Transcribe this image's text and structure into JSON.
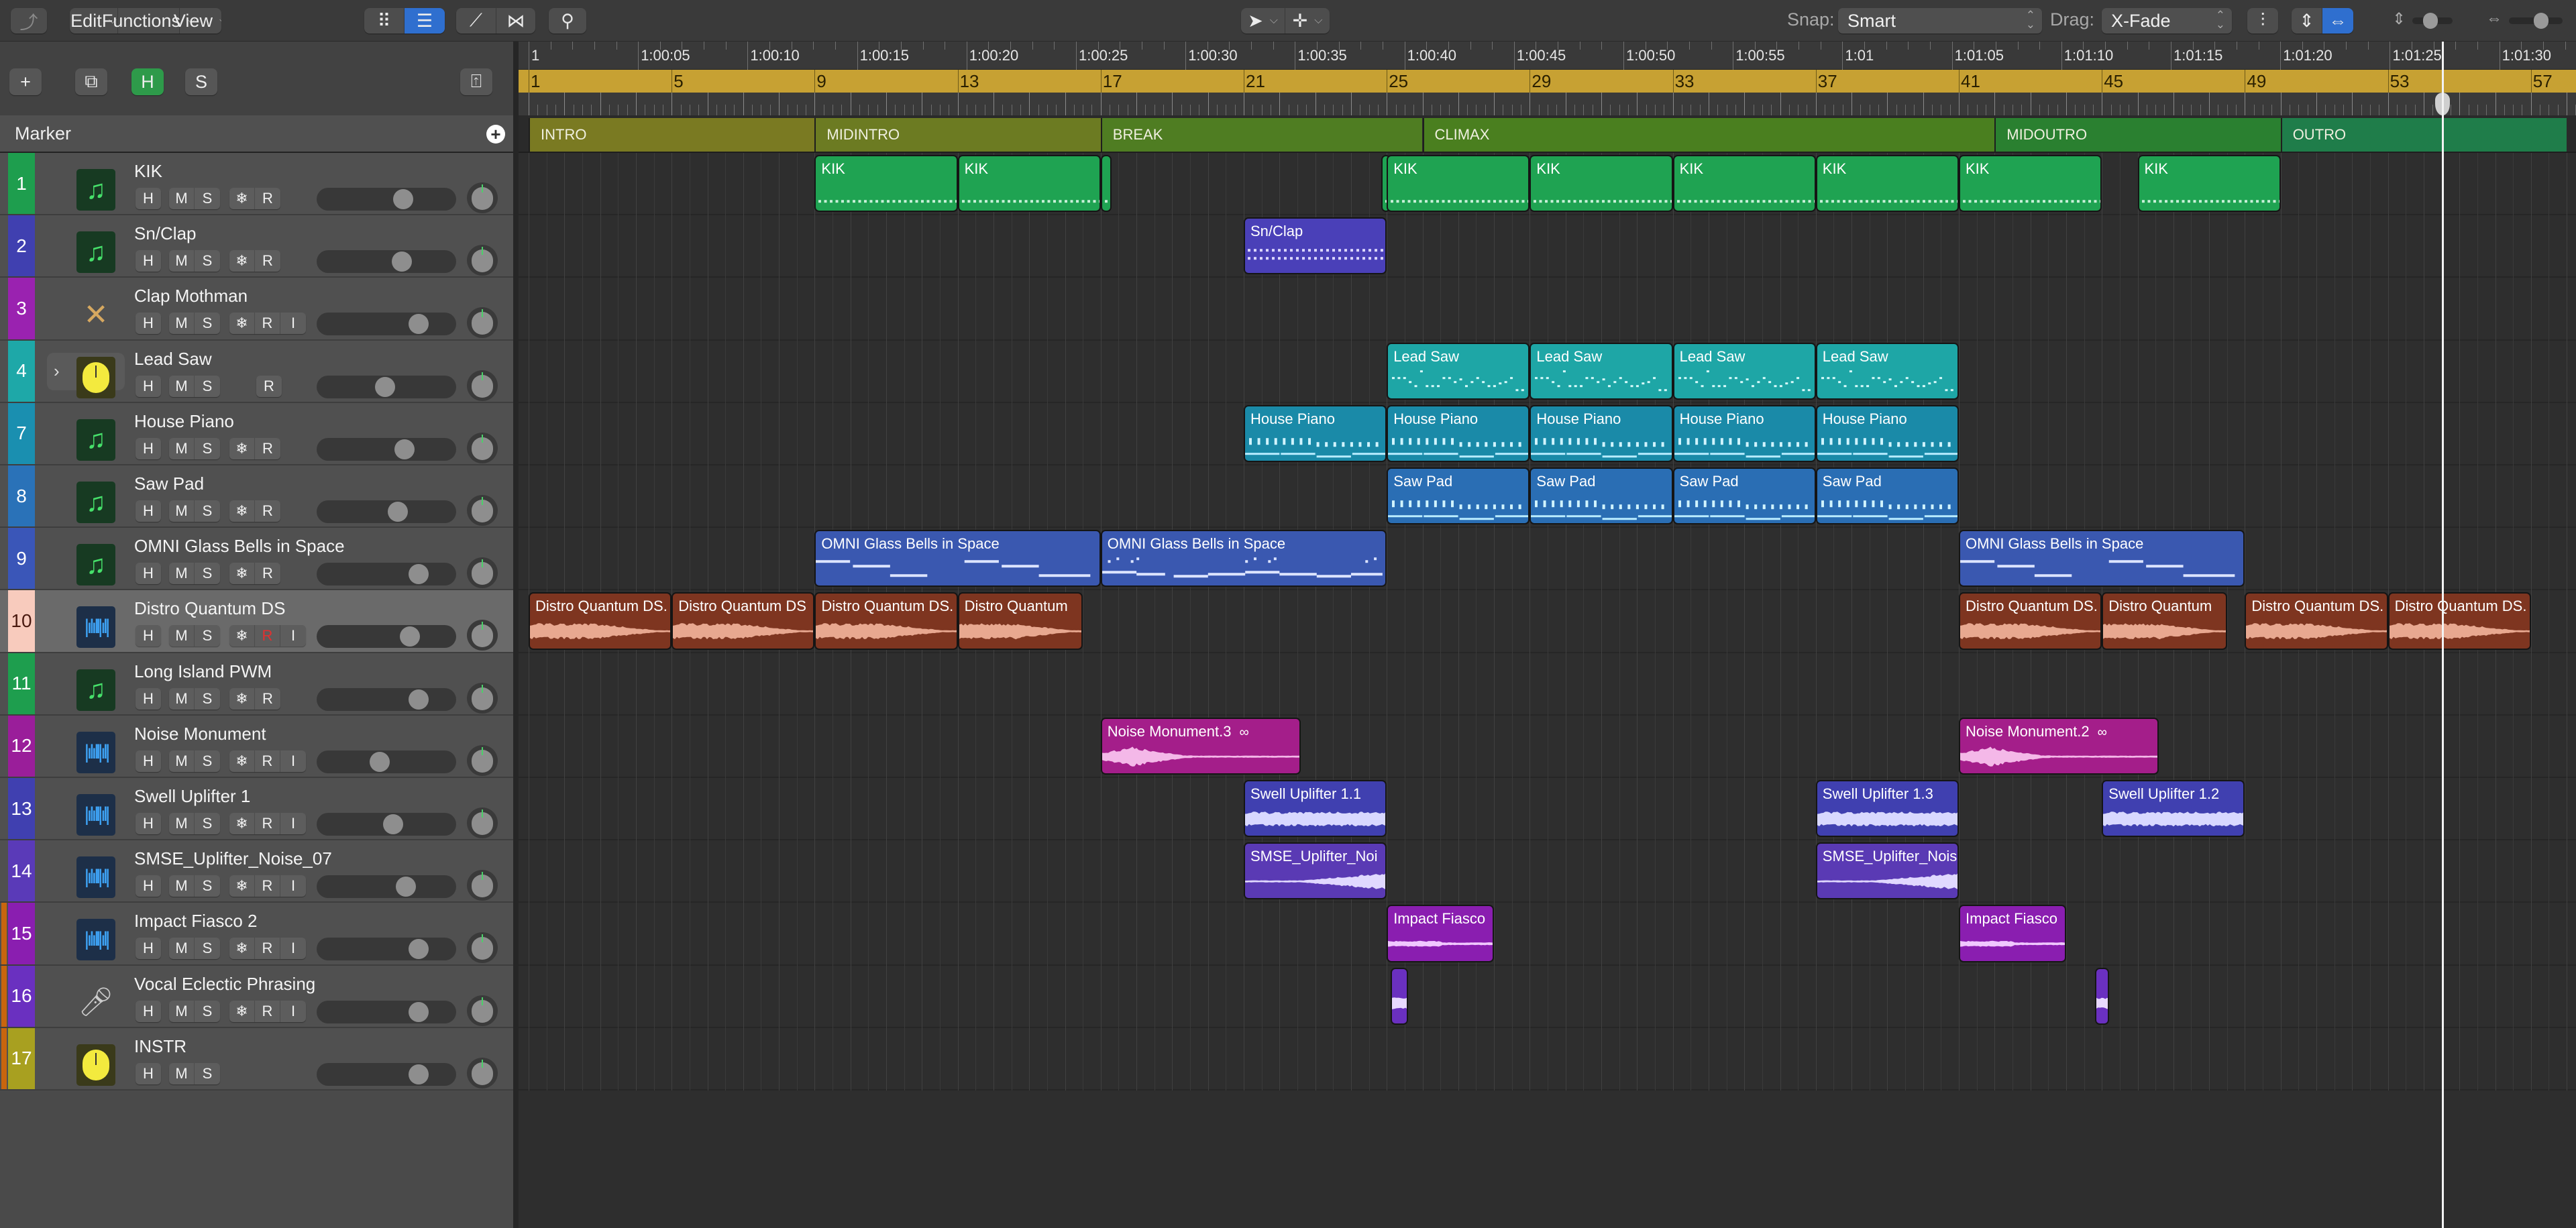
{
  "toolbar": {
    "back_icon": "back-arrow-icon",
    "menus": [
      {
        "label": "Edit",
        "icon": "chevron-down-icon"
      },
      {
        "label": "Functions",
        "icon": "chevron-down-icon"
      },
      {
        "label": "View",
        "icon": "chevron-down-icon"
      }
    ],
    "view_buttons": [
      {
        "icon": "grid-view-icon",
        "active": false
      },
      {
        "icon": "list-view-icon",
        "active": true
      }
    ],
    "automation_buttons": [
      {
        "icon": "automation-curve-icon"
      },
      {
        "icon": "flex-icon"
      }
    ],
    "catch_icon": "catch-playhead-icon",
    "tools": [
      {
        "icon": "pointer-tool-icon"
      },
      {
        "icon": "crosshair-tool-icon"
      }
    ],
    "snap_label": "Snap:",
    "snap_value": "Smart",
    "drag_label": "Drag:",
    "drag_value": "X-Fade",
    "waveform_zoom_icon": "waveform-zoom-icon",
    "vertical_fit_icon": "vertical-fit-icon",
    "horizontal_fit_icon": "horizontal-fit-icon",
    "vertical_zoom_icon": "vertical-zoom-icon",
    "horizontal_zoom_icon": "horizontal-zoom-icon",
    "vertical_zoom_level": 0.45,
    "horizontal_zoom_level": 0.6
  },
  "header_tools": {
    "add_label": "+",
    "duplicate_icon": "duplicate-track-icon",
    "h_label": "H",
    "s_label": "S",
    "collapse_icon": "collapse-panel-icon"
  },
  "marker_track": {
    "label": "Marker",
    "add_icon": "plus-circle-icon"
  },
  "ruler": {
    "time_labels": [
      "1",
      "1:00:05",
      "1:00:10",
      "1:00:15",
      "1:00:20",
      "1:00:25",
      "1:00:30",
      "1:00:35",
      "1:00:40",
      "1:00:45",
      "1:00:50",
      "1:00:55",
      "1:01",
      "1:01:05",
      "1:01:10",
      "1:01:15",
      "1:01:20",
      "1:01:25",
      "1:01:30"
    ],
    "bar_labels": [
      "1",
      "5",
      "9",
      "13",
      "17",
      "21",
      "25",
      "29",
      "33",
      "37",
      "41",
      "45",
      "49",
      "53",
      "57"
    ],
    "playhead_bar": 54.5
  },
  "markers": [
    {
      "name": "INTRO",
      "start": 1,
      "end": 9,
      "color": "#7a7a22"
    },
    {
      "name": "MIDINTRO",
      "start": 9,
      "end": 17,
      "color": "#6c7b22"
    },
    {
      "name": "BREAK",
      "start": 17,
      "end": 26,
      "color": "#4f7d22"
    },
    {
      "name": "CLIMAX",
      "start": 26,
      "end": 42,
      "color": "#4a7f1f"
    },
    {
      "name": "MIDOUTRO",
      "start": 42,
      "end": 50,
      "color": "#2a8030"
    },
    {
      "name": "OUTRO",
      "start": 50,
      "end": 58,
      "color": "#1f7d4a"
    }
  ],
  "tracks": [
    {
      "number": "1",
      "name": "KIK",
      "color": "#1e9e4e",
      "icon": "midi-note-icon",
      "buttons": [
        "H",
        "M",
        "S",
        "❄",
        "R"
      ],
      "volume": 0.62,
      "selected": false,
      "folder": false,
      "expand": false
    },
    {
      "number": "2",
      "name": "Sn/Clap",
      "color": "#4040b0",
      "icon": "midi-note-icon",
      "buttons": [
        "H",
        "M",
        "S",
        "❄",
        "R"
      ],
      "volume": 0.61,
      "selected": false,
      "folder": false,
      "expand": false
    },
    {
      "number": "3",
      "name": "Clap Mothman",
      "color": "#9a22b0",
      "icon": "drumsticks-icon",
      "buttons": [
        "H",
        "M",
        "S",
        "❄",
        "R",
        "I"
      ],
      "volume": 0.73,
      "selected": false,
      "folder": false,
      "expand": false
    },
    {
      "number": "4",
      "name": "Lead Saw",
      "color": "#1ea8a8",
      "icon": "instrument-knob-icon",
      "buttons": [
        "H",
        "M",
        "S",
        "R"
      ],
      "volume": 0.49,
      "selected": false,
      "folder": false,
      "expand": true
    },
    {
      "number": "7",
      "name": "House Piano",
      "color": "#1a8fb0",
      "icon": "midi-note-icon",
      "buttons": [
        "H",
        "M",
        "S",
        "❄",
        "R"
      ],
      "volume": 0.63,
      "selected": false,
      "folder": false,
      "expand": false
    },
    {
      "number": "8",
      "name": "Saw Pad",
      "color": "#2a72b8",
      "icon": "midi-note-icon",
      "buttons": [
        "H",
        "M",
        "S",
        "❄",
        "R"
      ],
      "volume": 0.58,
      "selected": false,
      "folder": false,
      "expand": false
    },
    {
      "number": "9",
      "name": "OMNI Glass Bells in Space",
      "color": "#3a56b8",
      "icon": "midi-note-icon",
      "buttons": [
        "H",
        "M",
        "S",
        "❄",
        "R"
      ],
      "volume": 0.73,
      "selected": false,
      "folder": false,
      "expand": false
    },
    {
      "number": "10",
      "name": "Distro Quantum DS",
      "color": "#f8cbbd",
      "number_color": "#4a1a10",
      "icon": "audio-waveform-icon",
      "buttons": [
        "H",
        "M",
        "S",
        "❄",
        "R",
        "I"
      ],
      "red_button": "R",
      "volume": 0.67,
      "selected": true,
      "folder": false,
      "expand": false
    },
    {
      "number": "11",
      "name": "Long Island PWM",
      "color": "#1e9e4e",
      "icon": "midi-note-icon",
      "buttons": [
        "H",
        "M",
        "S",
        "❄",
        "R"
      ],
      "volume": 0.73,
      "selected": false,
      "folder": false,
      "expand": false
    },
    {
      "number": "12",
      "name": "Noise Monument",
      "color": "#9a1e9a",
      "icon": "audio-waveform-icon",
      "buttons": [
        "H",
        "M",
        "S",
        "❄",
        "R",
        "I"
      ],
      "volume": 0.45,
      "selected": false,
      "folder": false,
      "expand": false
    },
    {
      "number": "13",
      "name": "Swell Uplifter 1",
      "color": "#4040b0",
      "icon": "audio-waveform-icon",
      "buttons": [
        "H",
        "M",
        "S",
        "❄",
        "R",
        "I"
      ],
      "volume": 0.55,
      "selected": false,
      "folder": false,
      "expand": false
    },
    {
      "number": "14",
      "name": "SMSE_Uplifter_Noise_07",
      "color": "#5a3ab8",
      "icon": "audio-waveform-icon",
      "buttons": [
        "H",
        "M",
        "S",
        "❄",
        "R",
        "I"
      ],
      "volume": 0.64,
      "selected": false,
      "folder": false,
      "expand": false
    },
    {
      "number": "15",
      "name": "Impact Fiasco 2",
      "color": "#8a1eb0",
      "icon": "audio-waveform-icon",
      "buttons": [
        "H",
        "M",
        "S",
        "❄",
        "R",
        "I"
      ],
      "volume": 0.73,
      "selected": false,
      "folder": true,
      "expand": false
    },
    {
      "number": "16",
      "name": "Vocal Eclectic Phrasing",
      "color": "#6a30c0",
      "icon": "microphone-icon",
      "buttons": [
        "H",
        "M",
        "S",
        "❄",
        "R",
        "I"
      ],
      "volume": 0.73,
      "selected": false,
      "folder": true,
      "expand": false
    },
    {
      "number": "17",
      "name": "INSTR",
      "color": "#a8a020",
      "icon": "instrument-knob-icon",
      "buttons": [
        "H",
        "M",
        "S"
      ],
      "volume": 0.73,
      "selected": false,
      "folder": true,
      "expand": false
    }
  ],
  "regions": [
    {
      "track": 0,
      "name": "KIK",
      "start": 9,
      "end": 13,
      "kind": "drum",
      "color": "#1fa352"
    },
    {
      "track": 0,
      "name": "KIK",
      "start": 13,
      "end": 17,
      "kind": "drum",
      "color": "#1fa352"
    },
    {
      "track": 0,
      "name": "",
      "start": 17,
      "end": 17.3,
      "kind": "drum",
      "color": "#1fa352"
    },
    {
      "track": 0,
      "name": "",
      "start": 24.85,
      "end": 25.1,
      "kind": "drum",
      "color": "#1fa352"
    },
    {
      "track": 0,
      "name": "KIK",
      "start": 25,
      "end": 29,
      "kind": "drum",
      "color": "#1fa352"
    },
    {
      "track": 0,
      "name": "KIK",
      "start": 29,
      "end": 33,
      "kind": "drum",
      "color": "#1fa352"
    },
    {
      "track": 0,
      "name": "KIK",
      "start": 33,
      "end": 37,
      "kind": "drum",
      "color": "#1fa352"
    },
    {
      "track": 0,
      "name": "KIK",
      "start": 37,
      "end": 41,
      "kind": "drum",
      "color": "#1fa352"
    },
    {
      "track": 0,
      "name": "KIK",
      "start": 41,
      "end": 45,
      "kind": "drum",
      "color": "#1fa352"
    },
    {
      "track": 0,
      "name": "KIK",
      "start": 46,
      "end": 50,
      "kind": "drum",
      "color": "#1fa352"
    },
    {
      "track": 1,
      "name": "Sn/Clap",
      "start": 21,
      "end": 25,
      "kind": "snare",
      "color": "#4a40b8"
    },
    {
      "track": 3,
      "name": "Lead Saw",
      "start": 25,
      "end": 29,
      "kind": "lead",
      "color": "#1ea6a6"
    },
    {
      "track": 3,
      "name": "Lead Saw",
      "start": 29,
      "end": 33,
      "kind": "lead",
      "color": "#1ea6a6"
    },
    {
      "track": 3,
      "name": "Lead Saw",
      "start": 33,
      "end": 37,
      "kind": "lead",
      "color": "#1ea6a6"
    },
    {
      "track": 3,
      "name": "Lead Saw",
      "start": 37,
      "end": 41,
      "kind": "lead",
      "color": "#1ea6a6"
    },
    {
      "track": 4,
      "name": "House Piano",
      "start": 21,
      "end": 25,
      "kind": "chords",
      "color": "#1a8aa8"
    },
    {
      "track": 4,
      "name": "House Piano",
      "start": 25,
      "end": 29,
      "kind": "chords",
      "color": "#1a8aa8"
    },
    {
      "track": 4,
      "name": "House Piano",
      "start": 29,
      "end": 33,
      "kind": "chords",
      "color": "#1a8aa8"
    },
    {
      "track": 4,
      "name": "House Piano",
      "start": 33,
      "end": 37,
      "kind": "chords",
      "color": "#1a8aa8"
    },
    {
      "track": 4,
      "name": "House Piano",
      "start": 37,
      "end": 41,
      "kind": "chords",
      "color": "#1a8aa8"
    },
    {
      "track": 5,
      "name": "Saw Pad",
      "start": 25,
      "end": 29,
      "kind": "chords",
      "color": "#2a6eb4"
    },
    {
      "track": 5,
      "name": "Saw Pad",
      "start": 29,
      "end": 33,
      "kind": "chords",
      "color": "#2a6eb4"
    },
    {
      "track": 5,
      "name": "Saw Pad",
      "start": 33,
      "end": 37,
      "kind": "chords",
      "color": "#2a6eb4"
    },
    {
      "track": 5,
      "name": "Saw Pad",
      "start": 37,
      "end": 41,
      "kind": "chords",
      "color": "#2a6eb4"
    },
    {
      "track": 6,
      "name": "OMNI Glass Bells in Space",
      "start": 9,
      "end": 17,
      "kind": "bells",
      "color": "#3a58b0"
    },
    {
      "track": 6,
      "name": "OMNI Glass Bells in Space",
      "start": 17,
      "end": 25,
      "kind": "bells2",
      "color": "#3a58b0"
    },
    {
      "track": 6,
      "name": "OMNI Glass Bells in Space",
      "start": 41,
      "end": 49,
      "kind": "bells",
      "color": "#3a58b0"
    },
    {
      "track": 7,
      "name": "Distro Quantum DS.",
      "start": 1,
      "end": 5,
      "kind": "audio-decay",
      "color": "#7e3520",
      "wave": "#e8a890"
    },
    {
      "track": 7,
      "name": "Distro Quantum DS",
      "start": 5,
      "end": 9,
      "kind": "audio-decay",
      "color": "#7e3520",
      "wave": "#e8a890"
    },
    {
      "track": 7,
      "name": "Distro Quantum DS.",
      "start": 9,
      "end": 13,
      "kind": "audio-decay",
      "color": "#7e3520",
      "wave": "#e8a890"
    },
    {
      "track": 7,
      "name": "Distro Quantum",
      "start": 13,
      "end": 16.5,
      "kind": "audio-decay",
      "color": "#7e3520",
      "wave": "#e8a890"
    },
    {
      "track": 7,
      "name": "Distro Quantum DS.",
      "start": 41,
      "end": 45,
      "kind": "audio-decay",
      "color": "#7e3520",
      "wave": "#e8a890"
    },
    {
      "track": 7,
      "name": "Distro Quantum",
      "start": 45,
      "end": 48.5,
      "kind": "audio-decay",
      "color": "#7e3520",
      "wave": "#e8a890"
    },
    {
      "track": 7,
      "name": "Distro Quantum DS.",
      "start": 49,
      "end": 53,
      "kind": "audio-decay",
      "color": "#7e3520",
      "wave": "#e8a890"
    },
    {
      "track": 7,
      "name": "Distro Quantum DS.",
      "start": 53,
      "end": 57,
      "kind": "audio-decay",
      "color": "#7e3520",
      "wave": "#e8a890"
    },
    {
      "track": 9,
      "name": "Noise Monument.3",
      "start": 17,
      "end": 22.6,
      "kind": "audio-swell-decay",
      "color": "#a41e8a",
      "wave": "#f4b8e8",
      "loop_icon": "loop-icon"
    },
    {
      "track": 9,
      "name": "Noise Monument.2",
      "start": 41,
      "end": 46.6,
      "kind": "audio-swell-decay",
      "color": "#a41e8a",
      "wave": "#f4b8e8",
      "loop_icon": "loop-icon"
    },
    {
      "track": 10,
      "name": "Swell Uplifter 1.1",
      "start": 21,
      "end": 25,
      "kind": "audio-dense",
      "color": "#4040b0",
      "wave": "#d8d8ff"
    },
    {
      "track": 10,
      "name": "Swell Uplifter 1.3",
      "start": 37,
      "end": 41,
      "kind": "audio-dense",
      "color": "#4040b0",
      "wave": "#d8d8ff"
    },
    {
      "track": 10,
      "name": "Swell Uplifter 1.2",
      "start": 45,
      "end": 49,
      "kind": "audio-dense",
      "color": "#4040b0",
      "wave": "#d8d8ff"
    },
    {
      "track": 11,
      "name": "SMSE_Uplifter_Noi",
      "start": 21,
      "end": 25,
      "kind": "audio-rise",
      "color": "#5a3ab4",
      "wave": "#e0d8ff"
    },
    {
      "track": 11,
      "name": "SMSE_Uplifter_Nois",
      "start": 37,
      "end": 41,
      "kind": "audio-rise",
      "color": "#5a3ab4",
      "wave": "#e0d8ff"
    },
    {
      "track": 12,
      "name": "Impact Fiasco",
      "start": 25,
      "end": 28,
      "kind": "audio-hit",
      "color": "#8a1eb0",
      "wave": "#f0c8ff"
    },
    {
      "track": 12,
      "name": "Impact Fiasco",
      "start": 41,
      "end": 44,
      "kind": "audio-hit",
      "color": "#8a1eb0",
      "wave": "#f0c8ff"
    },
    {
      "track": 13,
      "name": "",
      "start": 25.1,
      "end": 25.6,
      "kind": "audio-tiny",
      "color": "#6a30c0",
      "wave": "#e8d8ff"
    },
    {
      "track": 13,
      "name": "",
      "start": 44.8,
      "end": 45.2,
      "kind": "audio-tiny",
      "color": "#6a30c0",
      "wave": "#e8d8ff"
    }
  ]
}
